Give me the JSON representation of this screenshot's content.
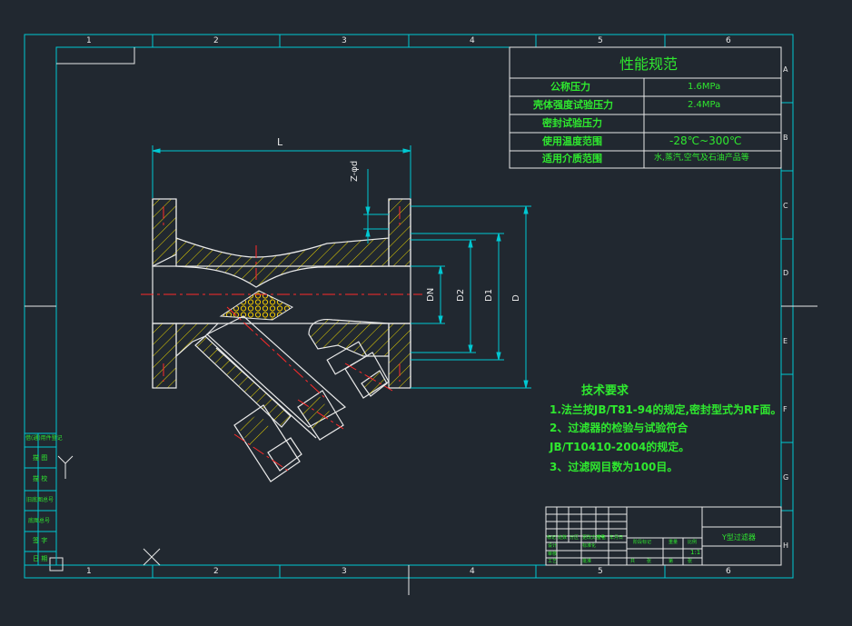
{
  "colors": {
    "background": "#212830",
    "frame": "#00c8d2",
    "geometry": "#ffffff",
    "hatch": "#e6d200",
    "centerline": "#ff2a2a",
    "dimension": "#00c8d2",
    "text_green": "#2fe82f",
    "text_white": "#e8e8e8",
    "screen_fill": "#f0c800"
  },
  "frame": {
    "columns": [
      "1",
      "2",
      "3",
      "4",
      "5",
      "6"
    ],
    "rows": [
      "A",
      "B",
      "C",
      "D",
      "E",
      "F",
      "G",
      "H"
    ]
  },
  "spec_table": {
    "title": "性能规范",
    "rows": [
      {
        "label": "公称压力",
        "value": "1.6MPa"
      },
      {
        "label": "壳体强度试验压力",
        "value": "2.4MPa"
      },
      {
        "label": "密封试验压力",
        "value": ""
      },
      {
        "label": "使用温度范围",
        "value": "-28℃~300℃"
      },
      {
        "label": "适用介质范围",
        "value": "水,蒸汽,空气及石油产品等"
      }
    ]
  },
  "dimensions": {
    "length": "L",
    "bolt_hole": "Z-φd",
    "nominal": "DN",
    "d2": "D2",
    "d1": "D1",
    "outer": "D"
  },
  "tech_requirements": {
    "title": "技术要求",
    "lines": [
      "1.法兰按JB/T81-94的规定,密封型式为RF面。",
      "2、过滤器的检验与试验符合",
      "JB/T10410-2004的规定。",
      "3、过滤网目数为100目。"
    ]
  },
  "side_table": {
    "labels": [
      "借(通)用件登记",
      "描 图",
      "描 校",
      "旧底图总号",
      "底图总号",
      "签 字",
      "日 期"
    ]
  },
  "title_block": {
    "drawing_name": "Y型过滤器",
    "scale": "1:1",
    "small_labels": [
      "标记",
      "处数",
      "分区",
      "更改文件号",
      "签名",
      "年月日",
      "设计",
      "标准化",
      "审核",
      "工艺",
      "批准",
      "阶段标记",
      "重量",
      "比例",
      "共",
      "张",
      "第",
      "张"
    ]
  }
}
